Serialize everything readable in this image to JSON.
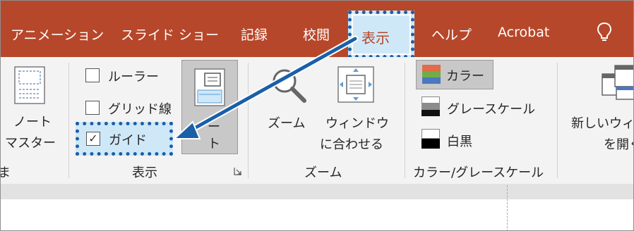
{
  "tabs": [
    {
      "label": "アニメーション"
    },
    {
      "label": "スライド ショー"
    },
    {
      "label": "記録"
    },
    {
      "label": "校閲"
    },
    {
      "label": "表示"
    },
    {
      "label": "ヘルプ"
    },
    {
      "label": "Acrobat"
    }
  ],
  "master_views": {
    "line1": "ノート",
    "line2": "マスター",
    "group_fragment": "ま"
  },
  "show_group": {
    "ruler_label": "ルーラー",
    "gridlines_label": "グリッド線",
    "guides_label": "ガイド",
    "guides_checked_mark": "✓",
    "notes_line1": "ー",
    "notes_line2": "ト",
    "group_label": "表示"
  },
  "zoom_group": {
    "zoom_label": "ズーム",
    "fit_line1": "ウィンドウ",
    "fit_line2": "に合わせる",
    "group_label": "ズーム"
  },
  "color_group": {
    "color_label": "カラー",
    "grayscale_label": "グレースケール",
    "bw_label": "白黒",
    "group_label": "カラー/グレースケール"
  },
  "window_group": {
    "line1": "新しいウィ",
    "line2": "を開く"
  },
  "colors": {
    "accent": "#b7472a",
    "highlight": "#cfe8f8",
    "callout": "#1a5fa8"
  }
}
